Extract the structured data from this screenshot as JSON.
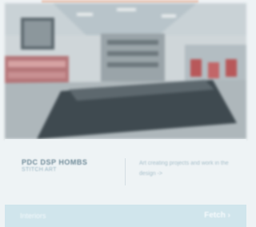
{
  "project": {
    "title": "PDC DSP HOMBS",
    "subtitle": "STITCH ART"
  },
  "description": "Art creating projects and work in the design ->",
  "footer": {
    "label": "Interiors",
    "link_label": "Fetch ›"
  },
  "colors": {
    "panel_background": "#eef3f5",
    "footer_background": "#d0e5ec",
    "title_text": "#6f8a98"
  }
}
